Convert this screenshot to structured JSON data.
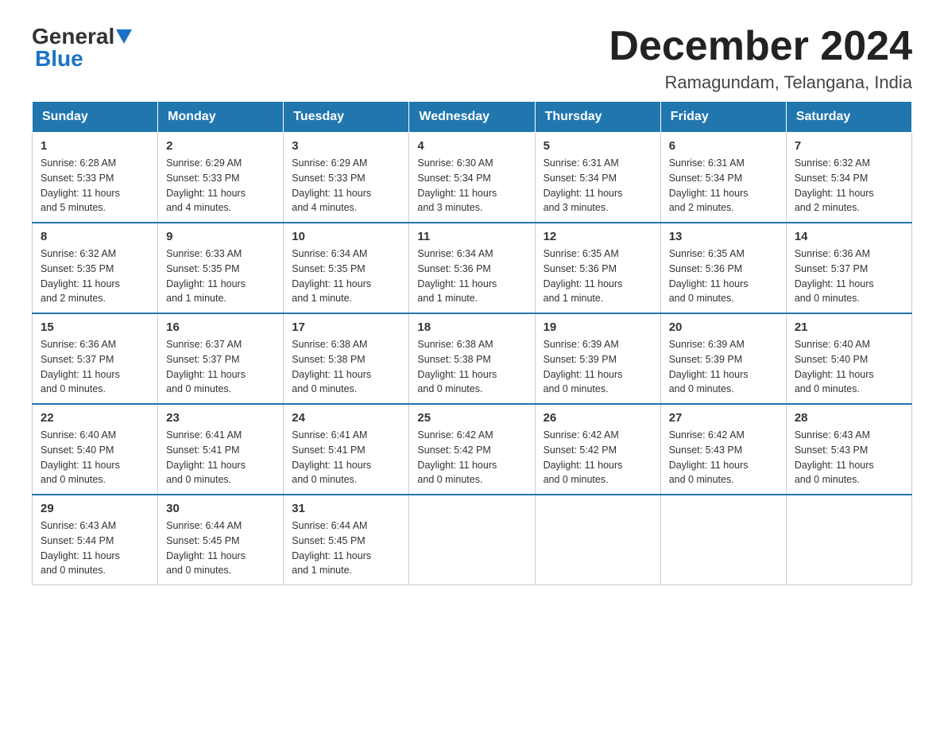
{
  "header": {
    "logo_general": "General",
    "logo_blue": "Blue",
    "month_title": "December 2024",
    "location": "Ramagundam, Telangana, India"
  },
  "days_of_week": [
    "Sunday",
    "Monday",
    "Tuesday",
    "Wednesday",
    "Thursday",
    "Friday",
    "Saturday"
  ],
  "weeks": [
    [
      {
        "num": "1",
        "info": "Sunrise: 6:28 AM\nSunset: 5:33 PM\nDaylight: 11 hours\nand 5 minutes."
      },
      {
        "num": "2",
        "info": "Sunrise: 6:29 AM\nSunset: 5:33 PM\nDaylight: 11 hours\nand 4 minutes."
      },
      {
        "num": "3",
        "info": "Sunrise: 6:29 AM\nSunset: 5:33 PM\nDaylight: 11 hours\nand 4 minutes."
      },
      {
        "num": "4",
        "info": "Sunrise: 6:30 AM\nSunset: 5:34 PM\nDaylight: 11 hours\nand 3 minutes."
      },
      {
        "num": "5",
        "info": "Sunrise: 6:31 AM\nSunset: 5:34 PM\nDaylight: 11 hours\nand 3 minutes."
      },
      {
        "num": "6",
        "info": "Sunrise: 6:31 AM\nSunset: 5:34 PM\nDaylight: 11 hours\nand 2 minutes."
      },
      {
        "num": "7",
        "info": "Sunrise: 6:32 AM\nSunset: 5:34 PM\nDaylight: 11 hours\nand 2 minutes."
      }
    ],
    [
      {
        "num": "8",
        "info": "Sunrise: 6:32 AM\nSunset: 5:35 PM\nDaylight: 11 hours\nand 2 minutes."
      },
      {
        "num": "9",
        "info": "Sunrise: 6:33 AM\nSunset: 5:35 PM\nDaylight: 11 hours\nand 1 minute."
      },
      {
        "num": "10",
        "info": "Sunrise: 6:34 AM\nSunset: 5:35 PM\nDaylight: 11 hours\nand 1 minute."
      },
      {
        "num": "11",
        "info": "Sunrise: 6:34 AM\nSunset: 5:36 PM\nDaylight: 11 hours\nand 1 minute."
      },
      {
        "num": "12",
        "info": "Sunrise: 6:35 AM\nSunset: 5:36 PM\nDaylight: 11 hours\nand 1 minute."
      },
      {
        "num": "13",
        "info": "Sunrise: 6:35 AM\nSunset: 5:36 PM\nDaylight: 11 hours\nand 0 minutes."
      },
      {
        "num": "14",
        "info": "Sunrise: 6:36 AM\nSunset: 5:37 PM\nDaylight: 11 hours\nand 0 minutes."
      }
    ],
    [
      {
        "num": "15",
        "info": "Sunrise: 6:36 AM\nSunset: 5:37 PM\nDaylight: 11 hours\nand 0 minutes."
      },
      {
        "num": "16",
        "info": "Sunrise: 6:37 AM\nSunset: 5:37 PM\nDaylight: 11 hours\nand 0 minutes."
      },
      {
        "num": "17",
        "info": "Sunrise: 6:38 AM\nSunset: 5:38 PM\nDaylight: 11 hours\nand 0 minutes."
      },
      {
        "num": "18",
        "info": "Sunrise: 6:38 AM\nSunset: 5:38 PM\nDaylight: 11 hours\nand 0 minutes."
      },
      {
        "num": "19",
        "info": "Sunrise: 6:39 AM\nSunset: 5:39 PM\nDaylight: 11 hours\nand 0 minutes."
      },
      {
        "num": "20",
        "info": "Sunrise: 6:39 AM\nSunset: 5:39 PM\nDaylight: 11 hours\nand 0 minutes."
      },
      {
        "num": "21",
        "info": "Sunrise: 6:40 AM\nSunset: 5:40 PM\nDaylight: 11 hours\nand 0 minutes."
      }
    ],
    [
      {
        "num": "22",
        "info": "Sunrise: 6:40 AM\nSunset: 5:40 PM\nDaylight: 11 hours\nand 0 minutes."
      },
      {
        "num": "23",
        "info": "Sunrise: 6:41 AM\nSunset: 5:41 PM\nDaylight: 11 hours\nand 0 minutes."
      },
      {
        "num": "24",
        "info": "Sunrise: 6:41 AM\nSunset: 5:41 PM\nDaylight: 11 hours\nand 0 minutes."
      },
      {
        "num": "25",
        "info": "Sunrise: 6:42 AM\nSunset: 5:42 PM\nDaylight: 11 hours\nand 0 minutes."
      },
      {
        "num": "26",
        "info": "Sunrise: 6:42 AM\nSunset: 5:42 PM\nDaylight: 11 hours\nand 0 minutes."
      },
      {
        "num": "27",
        "info": "Sunrise: 6:42 AM\nSunset: 5:43 PM\nDaylight: 11 hours\nand 0 minutes."
      },
      {
        "num": "28",
        "info": "Sunrise: 6:43 AM\nSunset: 5:43 PM\nDaylight: 11 hours\nand 0 minutes."
      }
    ],
    [
      {
        "num": "29",
        "info": "Sunrise: 6:43 AM\nSunset: 5:44 PM\nDaylight: 11 hours\nand 0 minutes."
      },
      {
        "num": "30",
        "info": "Sunrise: 6:44 AM\nSunset: 5:45 PM\nDaylight: 11 hours\nand 0 minutes."
      },
      {
        "num": "31",
        "info": "Sunrise: 6:44 AM\nSunset: 5:45 PM\nDaylight: 11 hours\nand 1 minute."
      },
      {
        "num": "",
        "info": ""
      },
      {
        "num": "",
        "info": ""
      },
      {
        "num": "",
        "info": ""
      },
      {
        "num": "",
        "info": ""
      }
    ]
  ]
}
